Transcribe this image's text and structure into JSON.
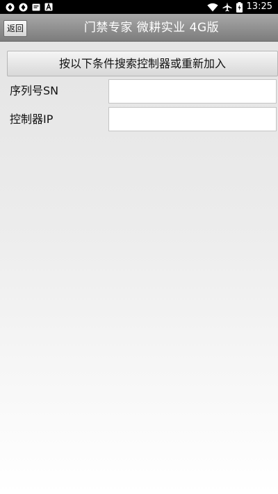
{
  "status_bar": {
    "time": "13:25",
    "left_icons": [
      "sync-icon",
      "sync-icon",
      "message-icon",
      "font-a-icon"
    ],
    "right_icons": [
      "wifi-icon",
      "airplane-icon",
      "battery-icon"
    ]
  },
  "header": {
    "back_label": "返回",
    "title": "门禁专家 微耕实业 4G版"
  },
  "main": {
    "search_button_label": "按以下条件搜索控制器或重新加入",
    "fields": {
      "sn": {
        "label": "序列号SN",
        "value": "",
        "placeholder": ""
      },
      "ip": {
        "label": "控制器IP",
        "value": "",
        "placeholder": ""
      }
    }
  },
  "colors": {
    "title_bar": "#8f8f8f",
    "status_bar": "#000000",
    "background": "#eeeeee"
  }
}
